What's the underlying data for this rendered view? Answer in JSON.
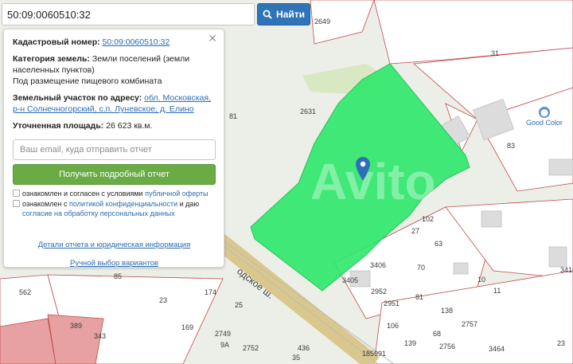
{
  "search": {
    "value": "50:09:0060510:32",
    "button_label": "Найти"
  },
  "panel": {
    "cadastral_label": "Кадастровый номер:",
    "cadastral_value": "50:09:0060510:32",
    "category_label": "Категория земель:",
    "category_value": "Земли поселений (земли населенных пунктов)",
    "purpose": "Под размещение пищевого комбината",
    "address_label": "Земельный участок по адресу:",
    "address_value": "обл. Московская, р-н Солнечногорский, с.п. Луневское, д. Елино",
    "area_label": "Уточненная площадь:",
    "area_value": "26 623 кв.м.",
    "email_placeholder": "Ваш email, куда отправить отчет",
    "submit_label": "Получить подробный отчет",
    "consent1_text": "ознакомлен и согласен с условиями",
    "consent1_link": "публичной оферты",
    "consent2_prefix": "ознакомлен с",
    "consent2_link1": "политикой конфиденциальности",
    "consent2_mid": "и даю",
    "consent2_link2": "согласие на обработку персональных данных",
    "details_link": "Детали отчета и юридическая информация",
    "manual_link": "Ручной выбор вариантов"
  },
  "map": {
    "labels": [
      "2649",
      "31",
      "2631",
      "83",
      "81",
      "27",
      "102",
      "63",
      "10",
      "11",
      "3418",
      "85",
      "562",
      "389",
      "343",
      "23",
      "174",
      "25",
      "169",
      "2749",
      "9A",
      "2752",
      "436",
      "35",
      "3405",
      "3406",
      "2952",
      "70",
      "2951",
      "81",
      "106",
      "139",
      "2757",
      "138",
      "2756",
      "3464",
      "185991",
      "23",
      "68"
    ],
    "road_label": "одское ш.",
    "poi_name": "Good Color",
    "watermark": "Avito"
  },
  "colors": {
    "parcel": "#2ee86a",
    "accent": "#2f73b8",
    "submit": "#6aab45"
  }
}
